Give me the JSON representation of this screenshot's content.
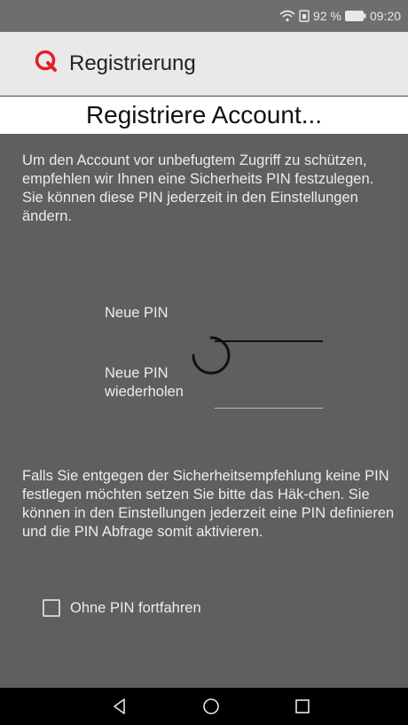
{
  "status_bar": {
    "battery": "92 %",
    "time": "09:20",
    "icons": [
      "wifi-icon",
      "sim-icon",
      "battery-icon"
    ]
  },
  "app_bar": {
    "logo": "q-logo-icon",
    "title": "Registrierung"
  },
  "banner": {
    "text": "Registriere Account..."
  },
  "content": {
    "intro": "Um den Account vor unbefugtem Zugriff zu schützen, empfehlen wir Ihnen eine Sicherheits PIN festzulegen. Sie können diese PIN jederzeit in den Einstellungen ändern.",
    "pin_label": "Neue PIN",
    "pin_repeat_label": "Neue PIN\nwiederholen",
    "pin_value": "",
    "pin_repeat_value": "",
    "info": "Falls Sie entgegen der Sicherheitsempfehlung keine PIN festlegen möchten setzen Sie bitte das Häk-chen. Sie können in den Einstellungen jederzeit eine PIN definieren und die PIN Abfrage somit aktivieren.",
    "checkbox_label": "Ohne PIN fortfahren",
    "checkbox_checked": false
  },
  "nav_bar": {
    "icons": [
      "back-icon",
      "home-icon",
      "recents-icon"
    ]
  },
  "colors": {
    "accent": "#e31e24",
    "overlay": "#5f5f5f"
  }
}
